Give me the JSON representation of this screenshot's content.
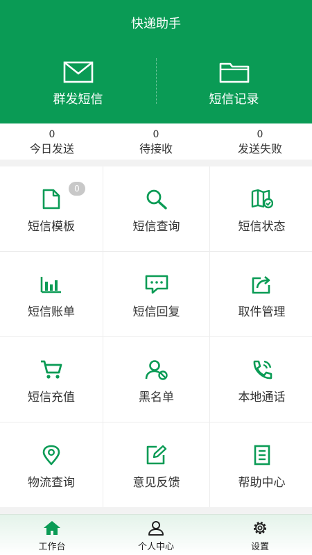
{
  "app": {
    "title": "快递助手"
  },
  "header": {
    "buttons": [
      {
        "label": "群发短信",
        "icon": "envelope-icon"
      },
      {
        "label": "短信记录",
        "icon": "folder-icon"
      }
    ]
  },
  "stats": [
    {
      "value": "0",
      "label": "今日发送"
    },
    {
      "value": "0",
      "label": "待接收"
    },
    {
      "value": "0",
      "label": "发送失败"
    }
  ],
  "grid": [
    {
      "label": "短信模板",
      "icon": "document-icon",
      "badge": "0"
    },
    {
      "label": "短信查询",
      "icon": "search-icon"
    },
    {
      "label": "短信状态",
      "icon": "map-status-icon"
    },
    {
      "label": "短信账单",
      "icon": "bar-chart-icon"
    },
    {
      "label": "短信回复",
      "icon": "message-icon"
    },
    {
      "label": "取件管理",
      "icon": "share-box-icon"
    },
    {
      "label": "短信充值",
      "icon": "cart-icon"
    },
    {
      "label": "黑名单",
      "icon": "user-block-icon"
    },
    {
      "label": "本地通话",
      "icon": "phone-icon"
    },
    {
      "label": "物流查询",
      "icon": "location-pin-icon"
    },
    {
      "label": "意见反馈",
      "icon": "edit-icon"
    },
    {
      "label": "帮助中心",
      "icon": "help-doc-icon"
    }
  ],
  "tabs": [
    {
      "label": "工作台",
      "icon": "home-icon",
      "active": true
    },
    {
      "label": "个人中心",
      "icon": "person-icon"
    },
    {
      "label": "设置",
      "icon": "settings-icon"
    }
  ],
  "colors": {
    "brand": "#0a9b55",
    "text": "#333333",
    "badge": "#c8c8c8"
  }
}
